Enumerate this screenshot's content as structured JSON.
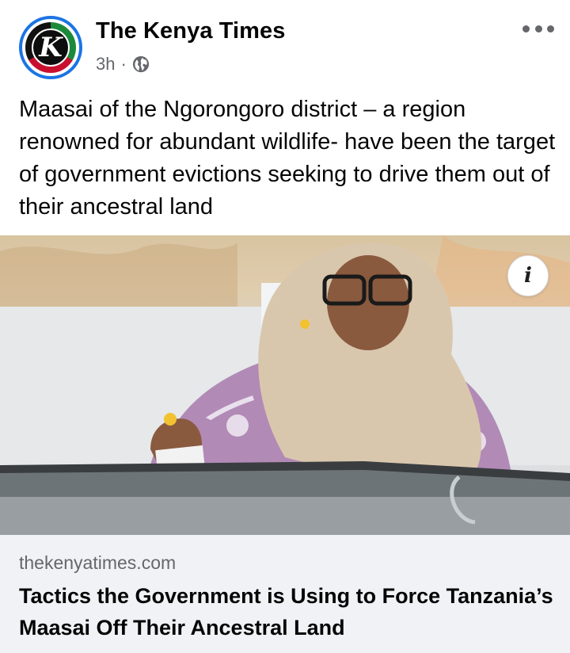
{
  "post": {
    "page_name": "The Kenya Times",
    "avatar_letter": "K",
    "time": "3h",
    "separator": "·",
    "privacy_icon": "globe-icon",
    "more_icon": "more-horizontal-icon",
    "caption": "Maasai of the Ngorongoro district – a region renowned for abundant wildlife- have been the target of government evictions seeking to drive them out of their ancestral land"
  },
  "link": {
    "info_label": "i",
    "domain": "thekenyatimes.com",
    "headline": "Tactics the Government is Using to Force Tanzania’s Maasai Off Their Ancestral Land"
  },
  "colors": {
    "accent": "#1b74e4",
    "secondary_text": "#65676b",
    "card_bg": "#f0f2f5"
  }
}
